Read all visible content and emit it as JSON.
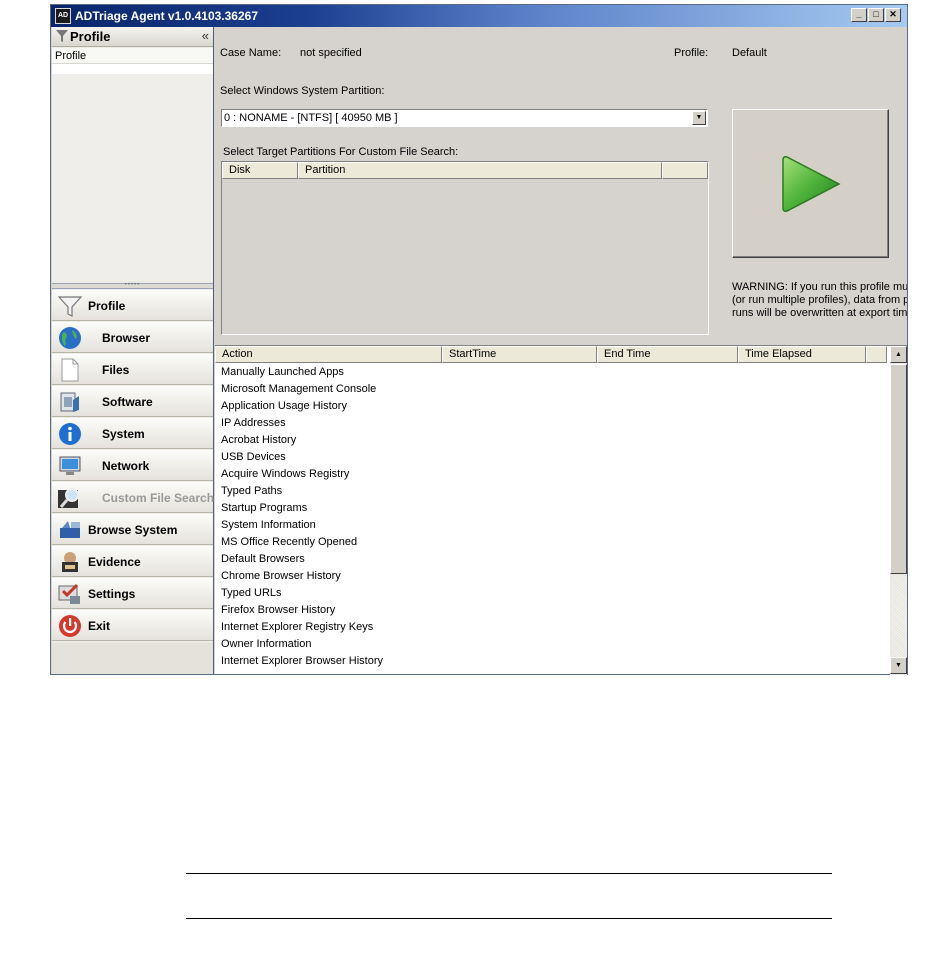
{
  "window": {
    "title": "ADTriage Agent v1.0.4103.36267",
    "app_icon_text": "AD",
    "minimize_glyph": "_",
    "maximize_glyph": "□",
    "close_glyph": "✕"
  },
  "left_panel": {
    "header_title": "Profile",
    "collapse_glyph": "«",
    "list_items": [
      "Profile"
    ],
    "nav": [
      {
        "label": "Profile",
        "icon": "funnel-icon"
      },
      {
        "label": "Browser",
        "icon": "globe-icon"
      },
      {
        "label": "Files",
        "icon": "file-icon"
      },
      {
        "label": "Software",
        "icon": "software-icon"
      },
      {
        "label": "System",
        "icon": "info-icon"
      },
      {
        "label": "Network",
        "icon": "monitor-icon"
      },
      {
        "label": "Custom File Search",
        "icon": "magnifier-icon",
        "disabled": true
      },
      {
        "label": "Browse System",
        "icon": "browse-icon"
      },
      {
        "label": "Evidence",
        "icon": "evidence-icon"
      },
      {
        "label": "Settings",
        "icon": "settings-icon"
      },
      {
        "label": "Exit",
        "icon": "power-icon"
      }
    ]
  },
  "main": {
    "case_name_label": "Case Name:",
    "case_name_value": "not specified",
    "profile_label": "Profile:",
    "profile_value": "Default",
    "partition_label": "Select Windows System Partition:",
    "partition_value": "0 : NONAME - [NTFS] [ 40950 MB ]",
    "target_label": "Select Target Partitions For Custom File Search:",
    "disk_columns": [
      "Disk",
      "Partition"
    ],
    "warning_lines": [
      "WARNING: If you run this profile mult",
      "(or run multiple profiles), data from pre",
      "runs will be overwritten at export time"
    ],
    "action_columns": [
      "Action",
      "StartTime",
      "End Time",
      "Time Elapsed"
    ],
    "actions": [
      "Manually Launched Apps",
      "Microsoft Management Console",
      "Application Usage History",
      "IP Addresses",
      "Acrobat History",
      "USB Devices",
      "Acquire Windows Registry",
      "Typed Paths",
      "Startup Programs",
      "System Information",
      "MS Office Recently Opened",
      "Default Browsers",
      "Chrome Browser History",
      "Typed URLs",
      "Firefox Browser History",
      "Internet Explorer Registry Keys",
      "Owner Information",
      "Internet Explorer Browser History"
    ]
  },
  "colors": {
    "accent_green": "#3aa834",
    "title_blue": "#0a246a"
  }
}
